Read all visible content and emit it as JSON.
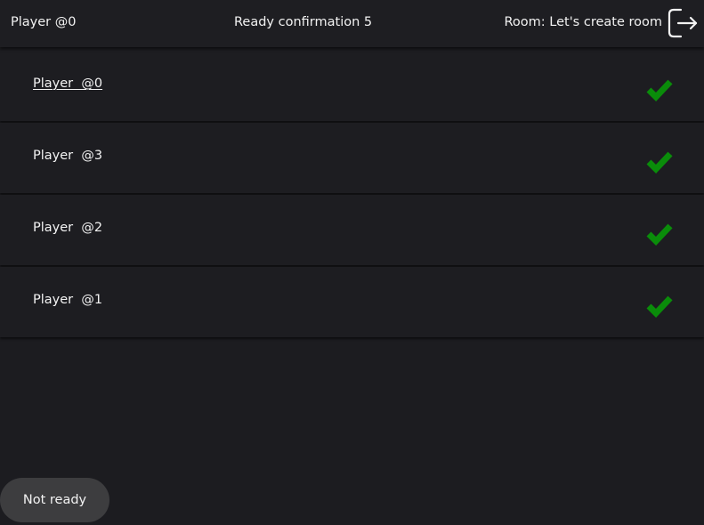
{
  "header": {
    "current_player": "Player  @0",
    "ready_confirmation": "Ready confirmation 5",
    "room": "Room: Let's create room",
    "exit_icon": "exit-door-icon"
  },
  "players": [
    {
      "name": "Player  @0",
      "is_self": true,
      "ready": true
    },
    {
      "name": "Player  @3",
      "is_self": false,
      "ready": true
    },
    {
      "name": "Player  @2",
      "is_self": false,
      "ready": true
    },
    {
      "name": "Player  @1",
      "is_self": false,
      "ready": true
    }
  ],
  "ready_icon": "checkmark-icon",
  "action": {
    "not_ready_label": "Not ready"
  },
  "colors": {
    "background": "#1c1c20",
    "row": "#1d1d21",
    "text": "#f2f2f2",
    "check": "#0a8c0a",
    "button": "#3d3d3f"
  }
}
